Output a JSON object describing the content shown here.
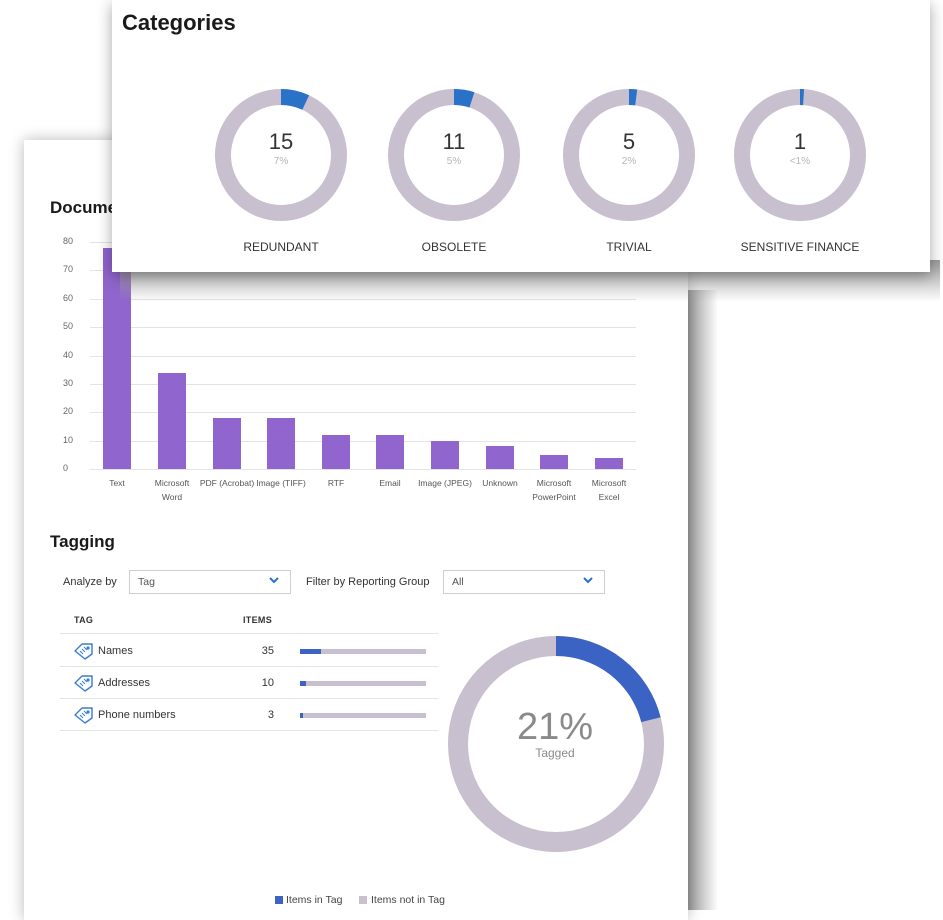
{
  "documents": {
    "title": "Documents",
    "chart_data": {
      "type": "bar",
      "title": "",
      "categories": [
        "Text",
        "Microsoft Word",
        "PDF (Acrobat)",
        "Image (TIFF)",
        "RTF",
        "Email",
        "Image (JPEG)",
        "Unknown",
        "Microsoft PowerPoint",
        "Microsoft Excel"
      ],
      "values": [
        78,
        34,
        18,
        18,
        12,
        12,
        10,
        8,
        5,
        4
      ],
      "yticks": [
        "0",
        "10",
        "20",
        "30",
        "40",
        "50",
        "60",
        "70",
        "80"
      ],
      "ylim": [
        0,
        80
      ],
      "color": "#9065cd",
      "grid": true
    }
  },
  "tagging": {
    "title": "Tagging",
    "analyze_label": "Analyze by",
    "analyze_value": "Tag",
    "filter_label": "Filter by Reporting Group",
    "filter_value": "All",
    "col_tag": "TAG",
    "col_items": "ITEMS",
    "rows": [
      {
        "name": "Names",
        "count": "35",
        "fraction": 0.17
      },
      {
        "name": "Addresses",
        "count": "10",
        "fraction": 0.05
      },
      {
        "name": "Phone numbers",
        "count": "3",
        "fraction": 0.02
      }
    ],
    "donut_pct": "21%",
    "donut_sub": "Tagged",
    "donut_fraction": 0.21,
    "legend_in": "Items in Tag",
    "legend_out": "Items not in Tag",
    "color_in": "#3a63c4",
    "color_out": "#c8bfcf"
  },
  "categories": {
    "title": "Categories",
    "items": [
      {
        "count": "15",
        "pct": "7%",
        "label": "REDUNDANT",
        "fraction": 0.07
      },
      {
        "count": "11",
        "pct": "5%",
        "label": "OBSOLETE",
        "fraction": 0.05
      },
      {
        "count": "5",
        "pct": "2%",
        "label": "TRIVIAL",
        "fraction": 0.02
      },
      {
        "count": "1",
        "pct": "<1%",
        "label": "SENSITIVE FINANCE",
        "fraction": 0.01
      }
    ],
    "color_fill": "#2a72c8",
    "color_track": "#c8bfcf"
  }
}
